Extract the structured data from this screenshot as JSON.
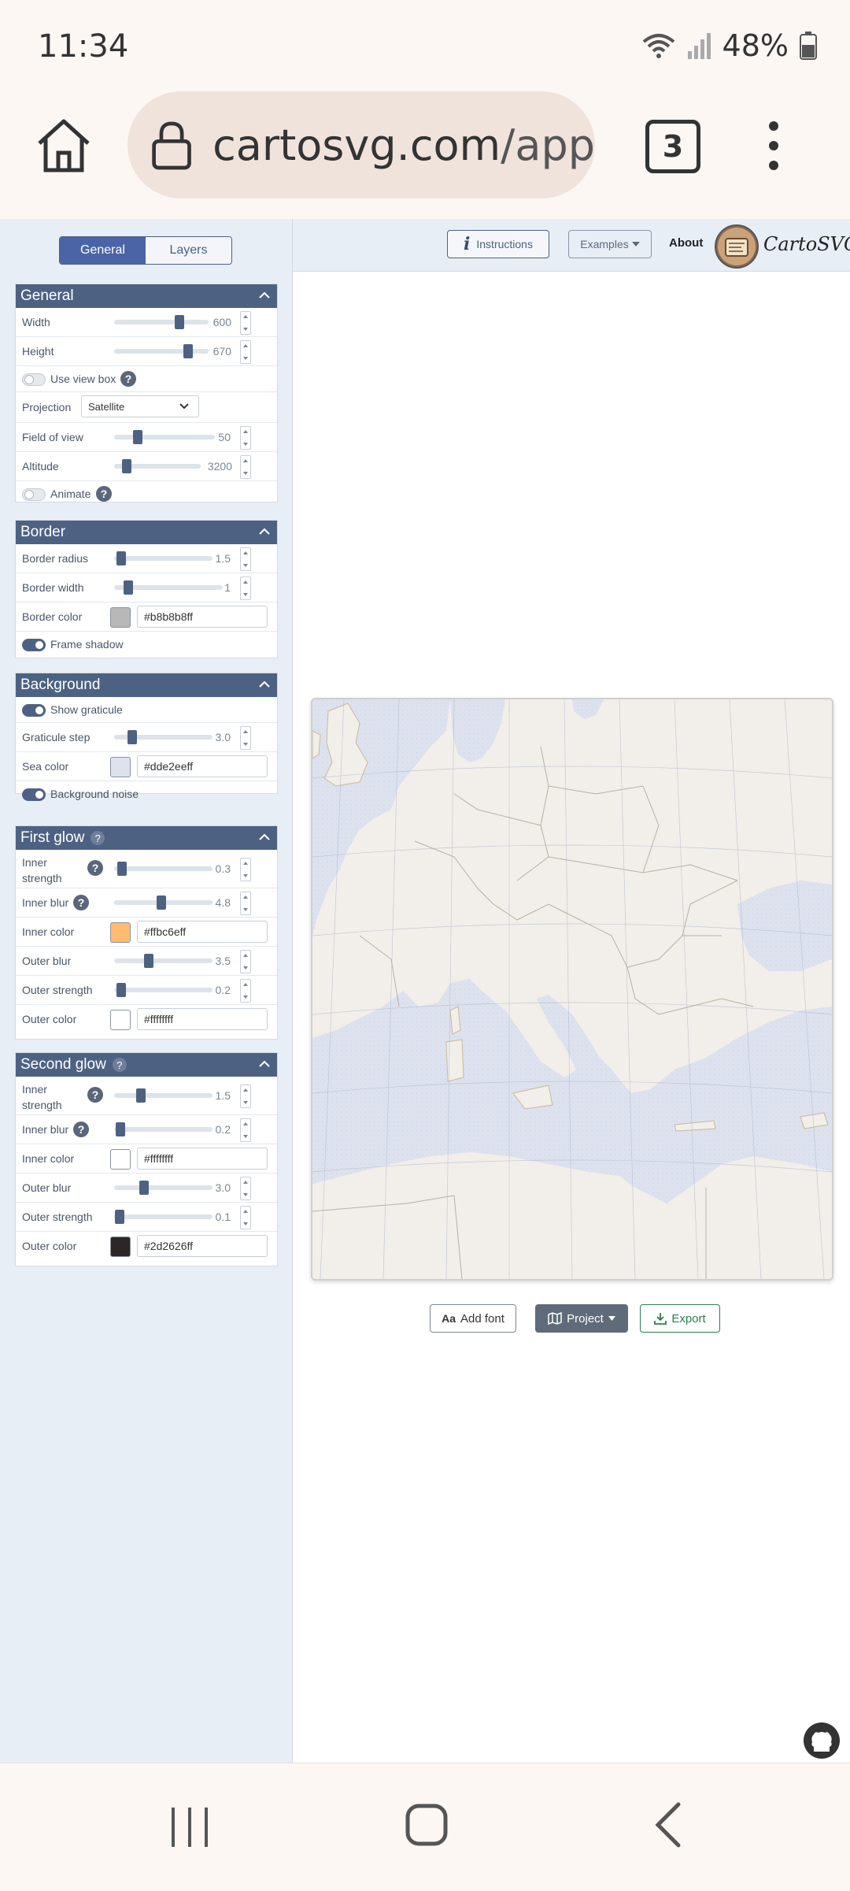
{
  "status_bar": {
    "time": "11:34",
    "battery": "48%"
  },
  "browser": {
    "url_host": "cartosvg.com",
    "url_path": "/app",
    "tab_count": "3"
  },
  "sidebar": {
    "tabs": [
      {
        "label": "General",
        "active": true
      },
      {
        "label": "Layers",
        "active": false
      }
    ],
    "general": {
      "title": "General",
      "width_label": "Width",
      "width_value": "600",
      "height_label": "Height",
      "height_value": "670",
      "viewbox_label": "Use view box",
      "projection_label": "Projection",
      "projection_value": "Satellite",
      "fov_label": "Field of view",
      "fov_value": "50",
      "altitude_label": "Altitude",
      "altitude_value": "3200",
      "animate_label": "Animate"
    },
    "border": {
      "title": "Border",
      "radius_label": "Border radius",
      "radius_value": "1.5",
      "width_label": "Border width",
      "width_value": "1",
      "color_label": "Border color",
      "color_value": "#b8b8b8ff",
      "color_swatch": "#b8b8b8",
      "shadow_label": "Frame shadow"
    },
    "background": {
      "title": "Background",
      "graticule_label": "Show graticule",
      "step_label": "Graticule step",
      "step_value": "3.0",
      "sea_label": "Sea color",
      "sea_value": "#dde2eeff",
      "sea_swatch": "#dde2ee",
      "noise_label": "Background noise"
    },
    "first_glow": {
      "title": "First glow",
      "inner_strength_label": "Inner strength",
      "inner_strength_value": "0.3",
      "inner_blur_label": "Inner blur",
      "inner_blur_value": "4.8",
      "inner_color_label": "Inner color",
      "inner_color_value": "#ffbc6eff",
      "inner_swatch": "#ffbc6e",
      "outer_blur_label": "Outer blur",
      "outer_blur_value": "3.5",
      "outer_strength_label": "Outer strength",
      "outer_strength_value": "0.2",
      "outer_color_label": "Outer color",
      "outer_color_value": "#ffffffff",
      "outer_swatch": "#ffffff"
    },
    "second_glow": {
      "title": "Second glow",
      "inner_strength_label": "Inner strength",
      "inner_strength_value": "1.5",
      "inner_blur_label": "Inner blur",
      "inner_blur_value": "0.2",
      "inner_color_label": "Inner color",
      "inner_color_value": "#ffffffff",
      "inner_swatch": "#ffffff",
      "outer_blur_label": "Outer blur",
      "outer_blur_value": "3.0",
      "outer_strength_label": "Outer strength",
      "outer_strength_value": "0.1",
      "outer_color_label": "Outer color",
      "outer_color_value": "#2d2626ff",
      "outer_swatch": "#2d2626"
    }
  },
  "topnav": {
    "instructions": "Instructions",
    "examples": "Examples",
    "about": "About",
    "brand": "CartoSVG"
  },
  "actions": {
    "add_font": "Add font",
    "project": "Project",
    "export": "Export"
  },
  "colors": {
    "header": "#4d6282",
    "accent": "#4a64a6",
    "export_green": "#2e7d4f",
    "land": "#f2eee9",
    "sea": "#dde2ee"
  }
}
